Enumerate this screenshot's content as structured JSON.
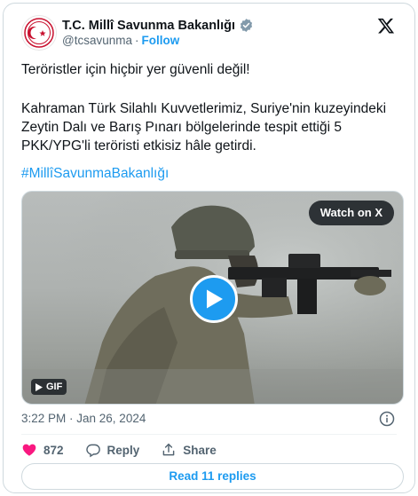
{
  "author": {
    "name": "T.C. Millî Savunma Bakanlığı",
    "handle": "@tcsavunma",
    "separator": "·",
    "follow_label": "Follow"
  },
  "tweet": {
    "line1": "Teröristler için hiçbir yer güvenli değil!",
    "line2": "Kahraman Türk Silahlı Kuvvetlerimiz, Suriye'nin kuzeyindeki Zeytin Dalı ve Barış Pınarı bölgelerinde tespit ettiği 5 PKK/YPG'li teröristi etkisiz hâle getirdi.",
    "hashtag": "#MillîSavunmaBakanlığı"
  },
  "media": {
    "watch_label": "Watch on X",
    "gif_label": "GIF"
  },
  "meta": {
    "timestamp": "3:22 PM · Jan 26, 2024"
  },
  "actions": {
    "like_count": "872",
    "reply_label": "Reply",
    "share_label": "Share"
  },
  "read_replies_label": "Read 11 replies",
  "colors": {
    "accent": "#1d9bf0",
    "like": "#f91880",
    "text": "#0f1419",
    "secondary": "#536471"
  }
}
